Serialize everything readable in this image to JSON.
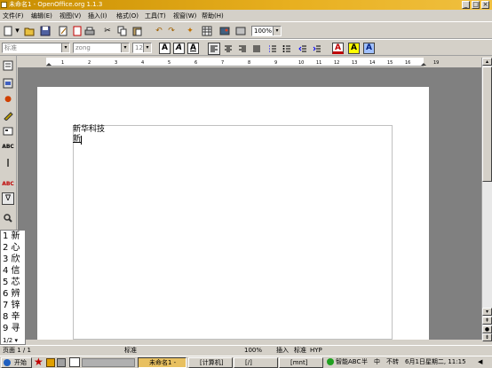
{
  "window": {
    "title": "未命名1 - OpenOffice.org 1.1.3"
  },
  "menu": [
    "文件(F)",
    "编辑(E)",
    "视图(V)",
    "插入(I)",
    "格式(O)",
    "工具(T)",
    "视窗(W)",
    "帮助(H)"
  ],
  "toolbar": {
    "zoom": "100%"
  },
  "format": {
    "style": "标准",
    "font": "zong",
    "size": "12"
  },
  "document": {
    "line1": "新华科技",
    "line2": "新"
  },
  "ime": {
    "candidates": [
      "1 新",
      "2 心",
      "3 欣",
      "4 信",
      "5 芯",
      "6 辨",
      "7 锌",
      "8 辛",
      "9 寻"
    ],
    "page": "1/2"
  },
  "status": {
    "page": "页面 1 / 1",
    "style": "标准",
    "zoom": "100%",
    "insert": "插入",
    "std": "标准",
    "hyp": "HYP"
  },
  "taskbar": {
    "start": "开始",
    "tasks": [
      "未命名1 -",
      "[计算机]",
      "[/]",
      "[mnt]"
    ],
    "ime": "智能ABC",
    "half": "半",
    "mid": "中",
    "lock": "不转",
    "clock": "6月1日星期二, 11:15"
  }
}
